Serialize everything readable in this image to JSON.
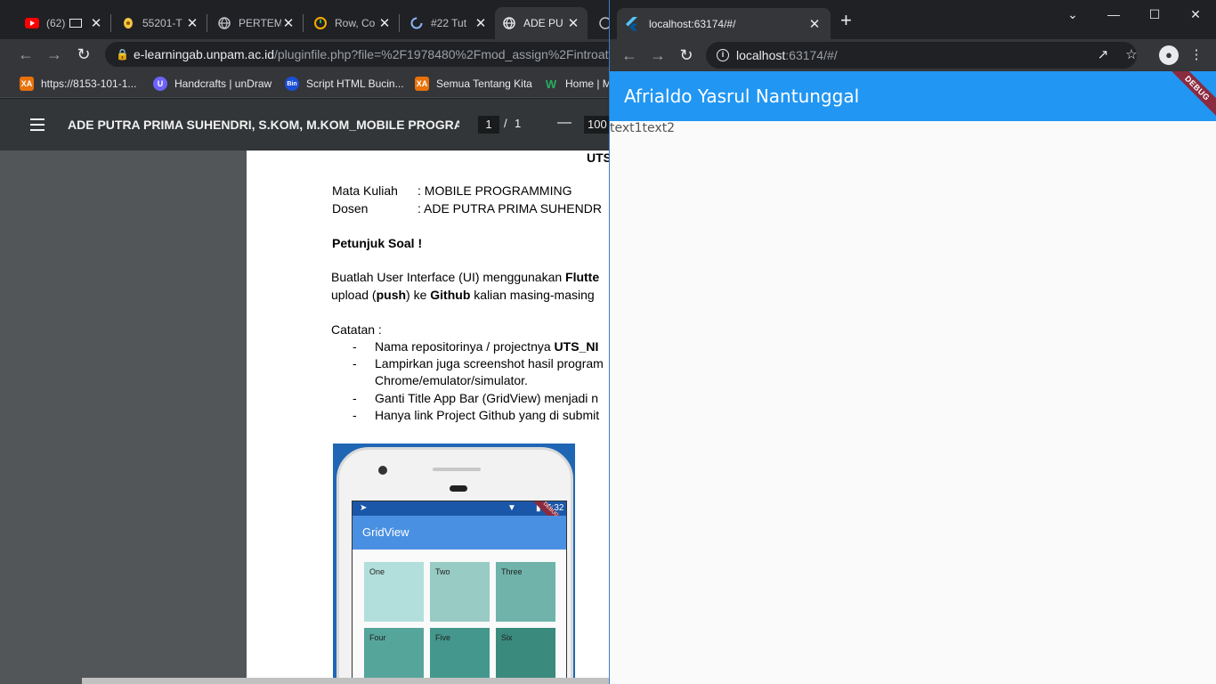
{
  "left_window": {
    "tabs": [
      {
        "label": "(62)",
        "icon": "youtube-icon"
      },
      {
        "label": "55201-T",
        "icon": "site-icon"
      },
      {
        "label": "PERTEM",
        "icon": "globe-icon"
      },
      {
        "label": "Row, Co",
        "icon": "flutter-docs-icon"
      },
      {
        "label": "#22 Tut",
        "icon": "loading-icon"
      },
      {
        "label": "ADE PU",
        "icon": "globe-icon"
      }
    ],
    "close_glyph": "✕",
    "url_host": "e-learningab.unpam.ac.id",
    "url_path": "/pluginfile.php?file=%2F1978480%2Fmod_assign%2Fintroatta",
    "bookmarks": [
      {
        "label": "https://8153-101-1...",
        "color": "#e8710a"
      },
      {
        "label": "Handcrafts | unDraw",
        "color": "#6c63ff"
      },
      {
        "label": "Script HTML Bucin...",
        "color": "#1a4fd6"
      },
      {
        "label": "Semua Tentang Kita",
        "color": "#e8710a"
      },
      {
        "label": "Home | M",
        "color": "#27ae60"
      }
    ],
    "bookmark_badges": [
      "XA",
      "U",
      "Bin",
      "XA",
      "W"
    ],
    "pdf": {
      "title": "ADE PUTRA PRIMA SUHENDRI, S.KOM, M.KOM_MOBILE PROGRAM...",
      "current_page": "1",
      "page_sep": "/",
      "total_pages": "1",
      "zoom_minus": "—",
      "zoom": "100",
      "page": {
        "heading": "UTS",
        "mata_kuliah_label": "Mata Kuliah",
        "mata_kuliah_value": ": MOBILE PROGRAMMING",
        "dosen_label": "Dosen",
        "dosen_value": ": ADE PUTRA PRIMA SUHENDR",
        "petunjuk": "Petunjuk Soal !",
        "para1_a": "Buatlah User Interface (UI) menggunakan ",
        "para1_b": "Flutte",
        "para2_a": "upload (",
        "para2_b": "push",
        "para2_c": ") ke ",
        "para2_d": "Github",
        "para2_e": " kalian masing-masing",
        "catatan": "Catatan :",
        "bullet": "-",
        "items": [
          {
            "a": "Nama repositorinya / projectnya ",
            "b": "UTS_NI"
          },
          {
            "a": "Lampirkan juga screenshot hasil program",
            "b": ""
          },
          {
            "a": "Chrome/emulator/simulator.",
            "b": ""
          },
          {
            "a": "Ganti Title App Bar (GridView) menjadi n",
            "b": ""
          },
          {
            "a": "Hanya link Project Github yang di submit",
            "b": ""
          }
        ],
        "phone": {
          "time": "5:32",
          "appbar_title": "GridView",
          "debug": "DEBUG",
          "tiles": [
            {
              "label": "One",
              "color": "#b2dfdb"
            },
            {
              "label": "Two",
              "color": "#97cbc4"
            },
            {
              "label": "Three",
              "color": "#6fb3aa"
            },
            {
              "label": "Four",
              "color": "#56a59b"
            },
            {
              "label": "Five",
              "color": "#44978c"
            },
            {
              "label": "Six",
              "color": "#3a8a7e"
            }
          ]
        }
      }
    }
  },
  "right_window": {
    "tab_title": "localhost:63174/#/",
    "close_glyph": "✕",
    "newtab_glyph": "+",
    "url_host": "localhost",
    "url_path": ":63174/#/",
    "window_controls": {
      "chevron": "⌄",
      "minimize": "—",
      "maximize": "☐",
      "close": "✕"
    },
    "app": {
      "appbar_title": "Afrialdo Yasrul Nantunggal",
      "appbar_color": "#2196f3",
      "debug_label": "DEBUG",
      "texts": [
        "text1",
        "text2"
      ]
    }
  }
}
